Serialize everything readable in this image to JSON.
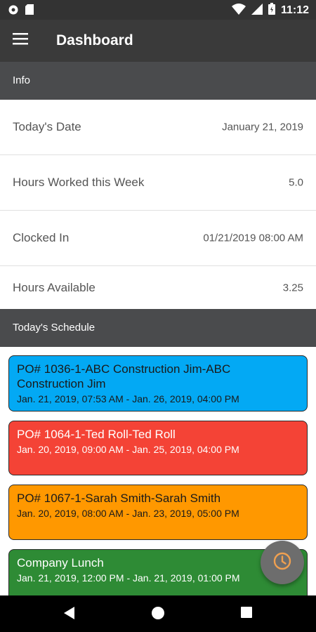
{
  "status_bar": {
    "time": "11:12"
  },
  "app_bar": {
    "title": "Dashboard"
  },
  "info_section": {
    "header": "Info",
    "rows": [
      {
        "label": "Today's Date",
        "value": "January 21, 2019"
      },
      {
        "label": "Hours Worked this Week",
        "value": "5.0"
      },
      {
        "label": "Clocked In",
        "value": "01/21/2019 08:00 AM"
      },
      {
        "label": "Hours Available",
        "value": "3.25"
      }
    ]
  },
  "schedule_section": {
    "header": "Today's Schedule",
    "items": [
      {
        "title": "PO# 1036-1-ABC Construction Jim-ABC Construction Jim",
        "dates": "Jan. 21, 2019, 07:53 AM - Jan. 26, 2019, 04:00 PM",
        "color": "#03a9f4",
        "text_color": "#1a1a1a"
      },
      {
        "title": "PO# 1064-1-Ted Roll-Ted Roll",
        "dates": "Jan. 20, 2019, 09:00 AM - Jan. 25, 2019, 04:00 PM",
        "color": "#f44336",
        "text_color": "#ffffff"
      },
      {
        "title": "PO# 1067-1-Sarah Smith-Sarah Smith",
        "dates": "Jan. 20, 2019, 08:00 AM - Jan. 23, 2019, 05:00 PM",
        "color": "#ff9800",
        "text_color": "#1a1a1a"
      },
      {
        "title": "Company Lunch",
        "dates": "Jan. 21, 2019, 12:00 PM - Jan. 21, 2019, 01:00 PM",
        "color": "#2e8b35",
        "text_color": "#ffffff"
      }
    ]
  },
  "fab": {
    "icon": "clock-icon",
    "icon_color": "#f0a050"
  },
  "icons": {
    "status_left": [
      "notification-icon",
      "sd-card-icon"
    ],
    "status_right": [
      "wifi-icon",
      "signal-icon",
      "battery-icon"
    ],
    "nav": [
      "back-icon",
      "home-icon",
      "recents-icon"
    ]
  }
}
